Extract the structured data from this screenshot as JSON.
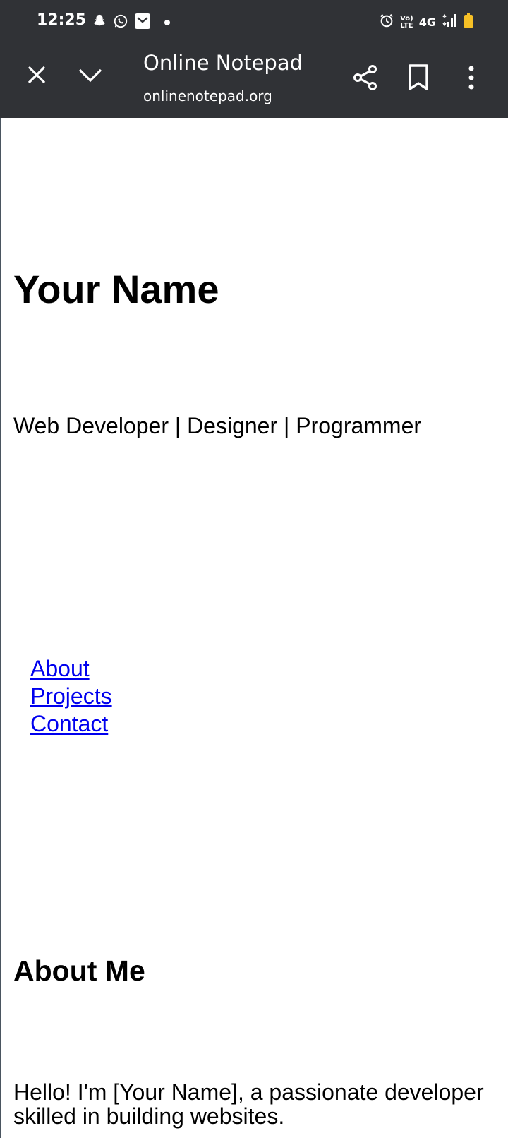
{
  "status_bar": {
    "time": "12:25",
    "network": "4G",
    "volte_top": "Vo)",
    "volte_bottom": "LTE",
    "icons_left": [
      "snapchat-icon",
      "whatsapp-icon",
      "mail-icon",
      "dot-icon"
    ],
    "icons_right": [
      "alarm-icon",
      "volte-icon",
      "signal-icon",
      "battery-icon"
    ],
    "battery_color": "#f6c026"
  },
  "toolbar": {
    "title": "Online Notepad",
    "url": "onlinenotepad.org",
    "icons": [
      "close-icon",
      "chevron-down-icon",
      "share-icon",
      "bookmark-icon",
      "more-vert-icon"
    ],
    "background": "#303236"
  },
  "page": {
    "name_heading": "Your Name",
    "tagline": "Web Developer | Designer | Programmer",
    "nav": [
      {
        "label": "About"
      },
      {
        "label": "Projects"
      },
      {
        "label": "Contact"
      }
    ],
    "link_color": "#0000ee",
    "about_heading": "About Me",
    "about_text": "Hello! I'm [Your Name], a passionate developer skilled in building websites."
  }
}
